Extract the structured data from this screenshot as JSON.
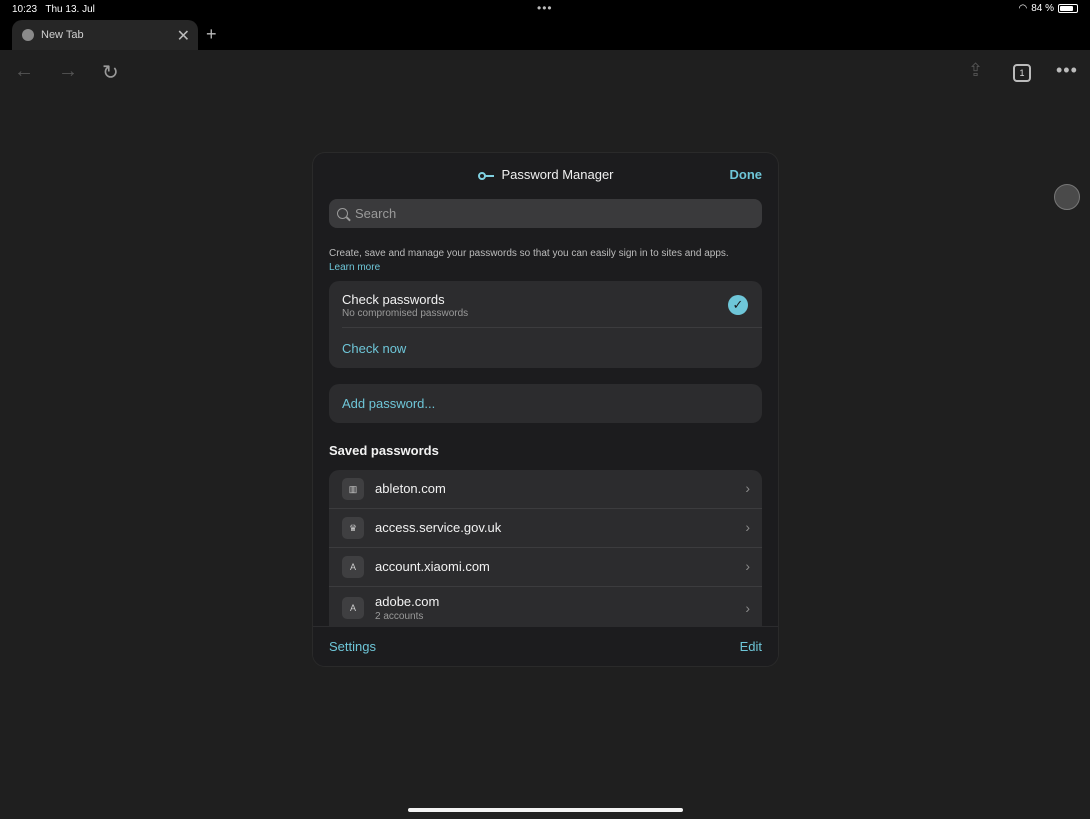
{
  "status_bar": {
    "time": "10:23",
    "date": "Thu 13. Jul",
    "battery": "84 %",
    "battery_level": 0.84
  },
  "tab": {
    "title": "New Tab",
    "count": "1"
  },
  "modal": {
    "title": "Password Manager",
    "done_label": "Done",
    "search_placeholder": "Search",
    "description": "Create, save and manage your passwords so that you can easily sign in to sites and apps.",
    "learn_more": "Learn more",
    "check": {
      "title": "Check passwords",
      "subtitle": "No compromised passwords",
      "action": "Check now"
    },
    "add_password": "Add password...",
    "saved_heading": "Saved passwords",
    "saved": [
      {
        "icon": "ableton-favicon",
        "glyph": "▥",
        "site": "ableton.com",
        "sub": ""
      },
      {
        "icon": "govuk-crown-favicon",
        "glyph": "♛",
        "site": "access.service.gov.uk",
        "sub": ""
      },
      {
        "icon": "letter-a-favicon",
        "glyph": "A",
        "site": "account.xiaomi.com",
        "sub": ""
      },
      {
        "icon": "letter-a-favicon",
        "glyph": "A",
        "site": "adobe.com",
        "sub": "2 accounts"
      }
    ],
    "footer": {
      "settings": "Settings",
      "edit": "Edit"
    }
  },
  "colors": {
    "accent": "#6ec6d8",
    "background": "#1f1f1f",
    "card": "#2c2c2e"
  }
}
